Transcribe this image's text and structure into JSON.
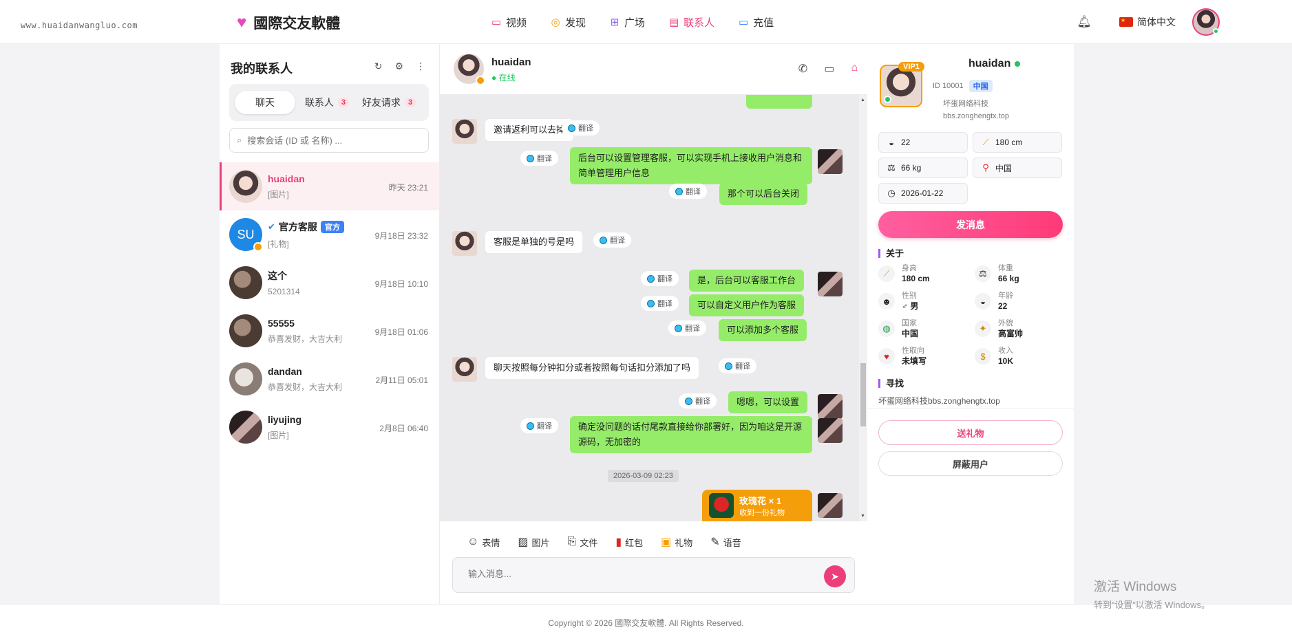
{
  "header": {
    "watermark": "www.huaidanwangluo.com",
    "brand": "國際交友軟體",
    "nav": [
      {
        "label": "视频",
        "icon": "video-icon"
      },
      {
        "label": "发现",
        "icon": "compass-icon"
      },
      {
        "label": "广场",
        "icon": "grid-icon"
      },
      {
        "label": "联系人",
        "icon": "chat-icon",
        "active": true
      },
      {
        "label": "充值",
        "icon": "card-icon"
      }
    ],
    "language": "简体中文"
  },
  "contacts": {
    "title": "我的联系人",
    "tabs": {
      "chat": "聊天",
      "contacts": "联系人",
      "contacts_count": "3",
      "requests": "好友请求",
      "requests_count": "3"
    },
    "search_placeholder": "搜索会话 (ID 或 名称) ...",
    "list": [
      {
        "name": "huaidan",
        "sub": "[图片]",
        "time": "昨天 23:21"
      },
      {
        "name": "官方客服",
        "tag": "官方",
        "avatar_text": "SU",
        "sub": "[礼物]",
        "time": "9月18日 23:32"
      },
      {
        "name": "这个",
        "sub": "5201314",
        "time": "9月18日 10:10"
      },
      {
        "name": "55555",
        "sub": "恭喜发财，大吉大利",
        "time": "9月18日 01:06"
      },
      {
        "name": "dandan",
        "sub": "恭喜发财，大吉大利",
        "time": "2月11日 05:01"
      },
      {
        "name": "liyujing",
        "sub": "[图片]",
        "time": "2月8日 06:40"
      }
    ]
  },
  "chat": {
    "name": "huaidan",
    "status": "在线",
    "translate_label": "翻译",
    "messages": [
      "邀请返利可以去掉",
      "后台可以设置管理客服，可以实现手机上接收用户消息和简单管理用户信息",
      "那个可以后台关闭",
      "客服是单独的号是吗",
      "是，后台可以客服工作台",
      "可以自定义用户作为客服",
      "可以添加多个客服",
      "聊天按照每分钟扣分或者按照每句话扣分添加了吗",
      "嗯嗯，可以设置",
      "确定没问题的话付尾款直接给你部署好，因为咱这是开源源码，无加密的"
    ],
    "timestamp": "2026-03-09 02:23",
    "gift": {
      "title": "玫瑰花 × 1",
      "subtitle": "收到一份礼物"
    },
    "tools": [
      "表情",
      "图片",
      "文件",
      "红包",
      "礼物",
      "语音"
    ],
    "input_placeholder": "输入消息..."
  },
  "profile": {
    "vip": "VIP1",
    "name": "huaidan",
    "id": "ID 10001",
    "country_tag": "中国",
    "org": "坏蛋网络科技",
    "site": "bbs.zonghengtx.top",
    "chips": {
      "age": "22",
      "height": "180 cm",
      "weight": "66 kg",
      "country": "中国",
      "date": "2026-01-22"
    },
    "send_message": "发消息",
    "about_title": "关于",
    "about": [
      {
        "label": "身高",
        "value": "180 cm"
      },
      {
        "label": "体重",
        "value": "66 kg"
      },
      {
        "label": "性别",
        "value": "♂ 男"
      },
      {
        "label": "年龄",
        "value": "22"
      },
      {
        "label": "国家",
        "value": "中国"
      },
      {
        "label": "外貌",
        "value": "高富帅"
      },
      {
        "label": "性取向",
        "value": "未填写"
      },
      {
        "label": "收入",
        "value": "10K"
      }
    ],
    "seek_title": "寻找",
    "seek_text": "坏蛋网络科技bbs.zonghengtx.top",
    "send_gift": "送礼物",
    "block_user": "屏蔽用户"
  },
  "footer": "Copyright © 2026 國際交友軟體. All Rights Reserved.",
  "windows": {
    "line1": "激活 Windows",
    "line2": "转到“设置”以激活 Windows。"
  },
  "colors": {
    "accent": "#ec3f7a",
    "bubble_out": "#95ec69",
    "online": "#22c55e",
    "vip": "#f59e0b"
  }
}
